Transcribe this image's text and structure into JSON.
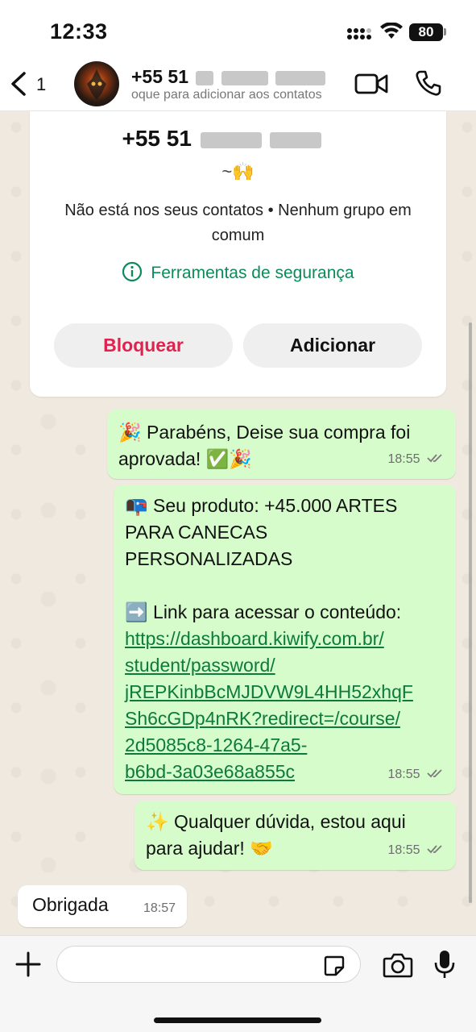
{
  "status_bar": {
    "time": "12:33",
    "battery": "80"
  },
  "header": {
    "back_count": "1",
    "contact_number": "+55 51",
    "contact_subtitle": "oque para adicionar aos contatos",
    "icons": [
      "back-chevron-icon",
      "video-camera-icon",
      "phone-icon"
    ]
  },
  "info_card": {
    "number": "+55 51",
    "alias": "~🙌",
    "description": "Não está nos seus contatos • Nenhum grupo em comum",
    "safety_label": "Ferramentas de segurança",
    "block_label": "Bloquear",
    "add_label": "Adicionar"
  },
  "messages": [
    {
      "direction": "out",
      "text_prefix": "🎉 Parabéns, Deise sua compra foi\naprovada! ✅🎉",
      "time": "18:55",
      "status": "read"
    },
    {
      "direction": "out",
      "text_prefix": "📭 Seu produto: +45.000 ARTES\nPARA CANECAS\nPERSONALIZADAS\n\n➡️ Link para acessar o conteúdo:",
      "link": "https://dashboard.kiwify.com.br/\nstudent/password/\njREPKinbBcMJDVW9L4HH52xhqF\nSh6cGDp4nRK?redirect=/course/\n2d5085c8-1264-47a5-\nb6bd-3a03e68a855c",
      "time": "18:55",
      "status": "read"
    },
    {
      "direction": "out",
      "text_prefix": "✨ Qualquer dúvida, estou aqui\npara ajudar! 🤝",
      "time": "18:55",
      "status": "read"
    },
    {
      "direction": "in",
      "text_prefix": "Obrigada",
      "time": "18:57"
    }
  ],
  "composer": {
    "placeholder": "",
    "icons": [
      "plus-icon",
      "sticker-icon",
      "camera-icon",
      "microphone-icon"
    ]
  },
  "colors": {
    "outgoing_bubble": "#d6fccb",
    "incoming_bubble": "#ffffff",
    "link": "#0c7a3c",
    "block_red": "#e0224f",
    "safety_green": "#0c8a5a"
  }
}
